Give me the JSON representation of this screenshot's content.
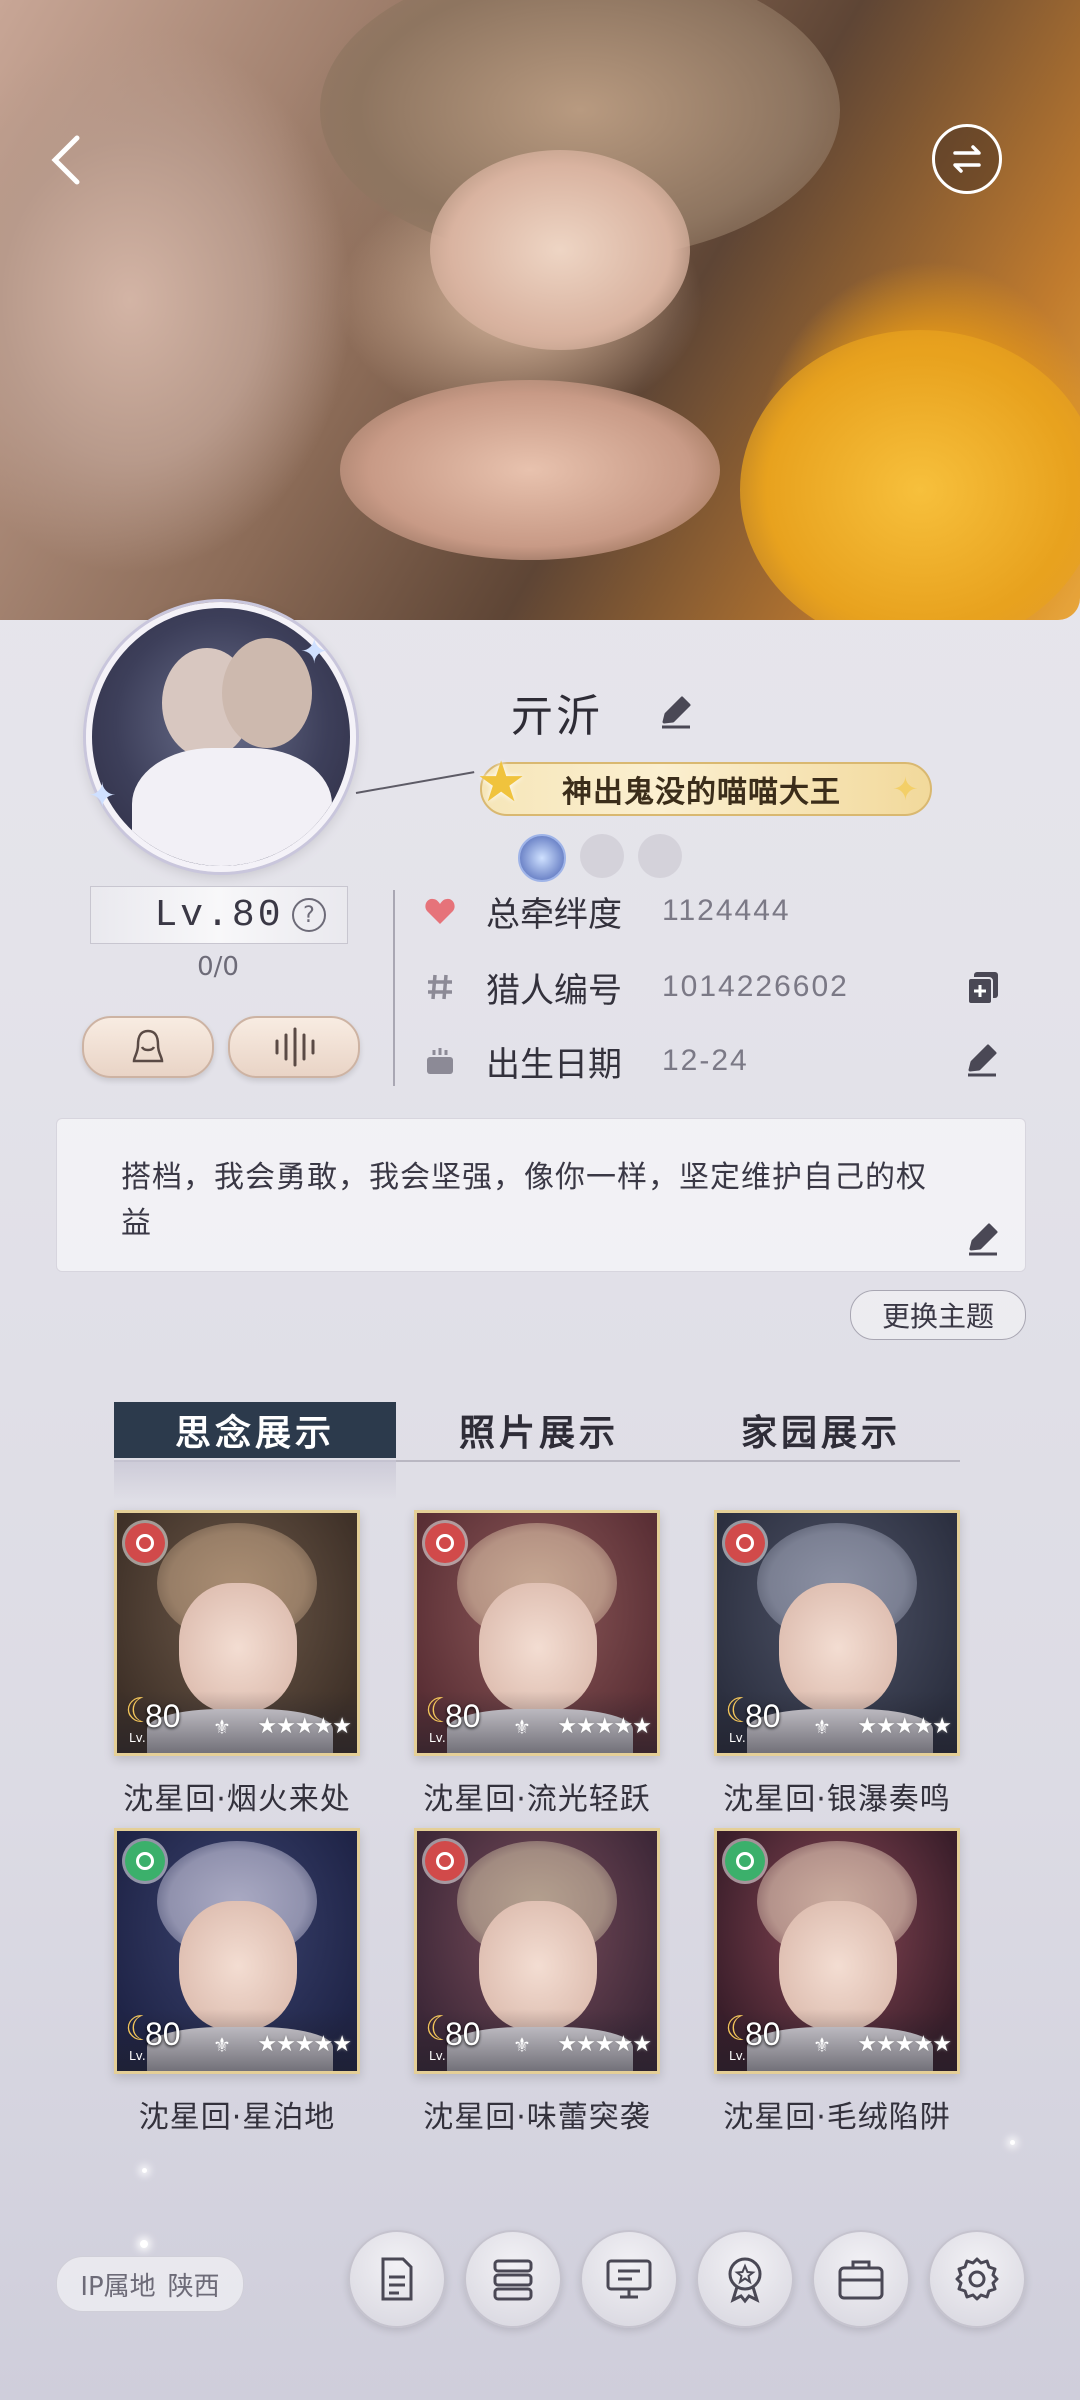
{
  "profile": {
    "name": "亓沂",
    "title": "神出鬼没的喵喵大王",
    "level": "Lv.80",
    "level_progress": "0/0"
  },
  "info": {
    "bond_label": "总牵绊度",
    "bond_value": "1124444",
    "id_label": "猎人编号",
    "id_value": "1014226602",
    "birthday_label": "出生日期",
    "birthday_value": "12-24"
  },
  "signature": "搭档，我会勇敢，我会坚强，像你一样，坚定维护自己的权益",
  "theme_button": "更换主题",
  "tabs": [
    {
      "label": "思念展示",
      "active": true
    },
    {
      "label": "照片展示",
      "active": false
    },
    {
      "label": "家园展示",
      "active": false
    }
  ],
  "cards": [
    {
      "name": "沈星回·烟火来处",
      "level": "80",
      "stars": "★★★★★",
      "badge": "red"
    },
    {
      "name": "沈星回·流光轻跃",
      "level": "80",
      "stars": "★★★★★",
      "badge": "red"
    },
    {
      "name": "沈星回·银瀑奏鸣",
      "level": "80",
      "stars": "★★★★★",
      "badge": "red"
    },
    {
      "name": "沈星回·星泊地",
      "level": "80",
      "stars": "★★★★★",
      "badge": "green"
    },
    {
      "name": "沈星回·味蕾突袭",
      "level": "80",
      "stars": "★★★★★",
      "badge": "red"
    },
    {
      "name": "沈星回·毛绒陷阱",
      "level": "80",
      "stars": "★★★★★",
      "badge": "green"
    }
  ],
  "ip": {
    "label": "IP属地",
    "value": "陕西"
  },
  "bottom_bar": [
    "document-icon",
    "list-icon",
    "monitor-icon",
    "medal-icon",
    "briefcase-icon",
    "gear-icon"
  ],
  "colors": {
    "accent_dark": "#2c3a4c",
    "heart": "#e6737a",
    "gold": "#e4cf97"
  }
}
